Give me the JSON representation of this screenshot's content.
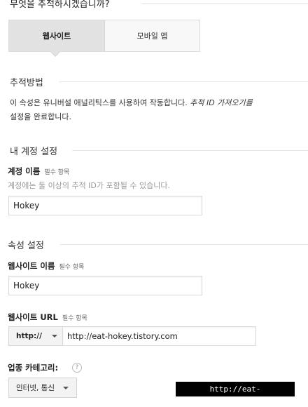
{
  "page": {
    "top_heading": "무엇을 추적하시겠습니까?"
  },
  "tracking_type": {
    "options": [
      "웹사이트",
      "모바일 앱"
    ],
    "selected": "웹사이트"
  },
  "tracking_method": {
    "title": "추적방법",
    "description_line1_prefix": "이 속성은 유니버설 애널리틱스를 사용하여 작동합니다. ",
    "description_line1_link": "추적 ID 가져오기를",
    "description_line2": "설정을 완료합니다."
  },
  "account_settings": {
    "title": "내 계정 설정",
    "account_name_label": "계정 이름",
    "required_label": "필수 항목",
    "account_name_help": "계정에는 둘 이상의 추적 ID가 포함될 수 있습니다.",
    "account_name_value": "Hokey"
  },
  "property_settings": {
    "title": "속성 설정",
    "website_name_label": "웹사이트 이름",
    "required_label": "필수 항목",
    "website_name_value": "Hokey",
    "website_url_label": "웹사이트 URL",
    "url_protocol": "http://",
    "website_url_value": "http://eat-hokey.tistory.com",
    "industry_label": "업종 카테고리:",
    "industry_help_icon": "?",
    "industry_value": "인터넷, 통신"
  },
  "watermark": "http://eat-hokey.tistory.com"
}
